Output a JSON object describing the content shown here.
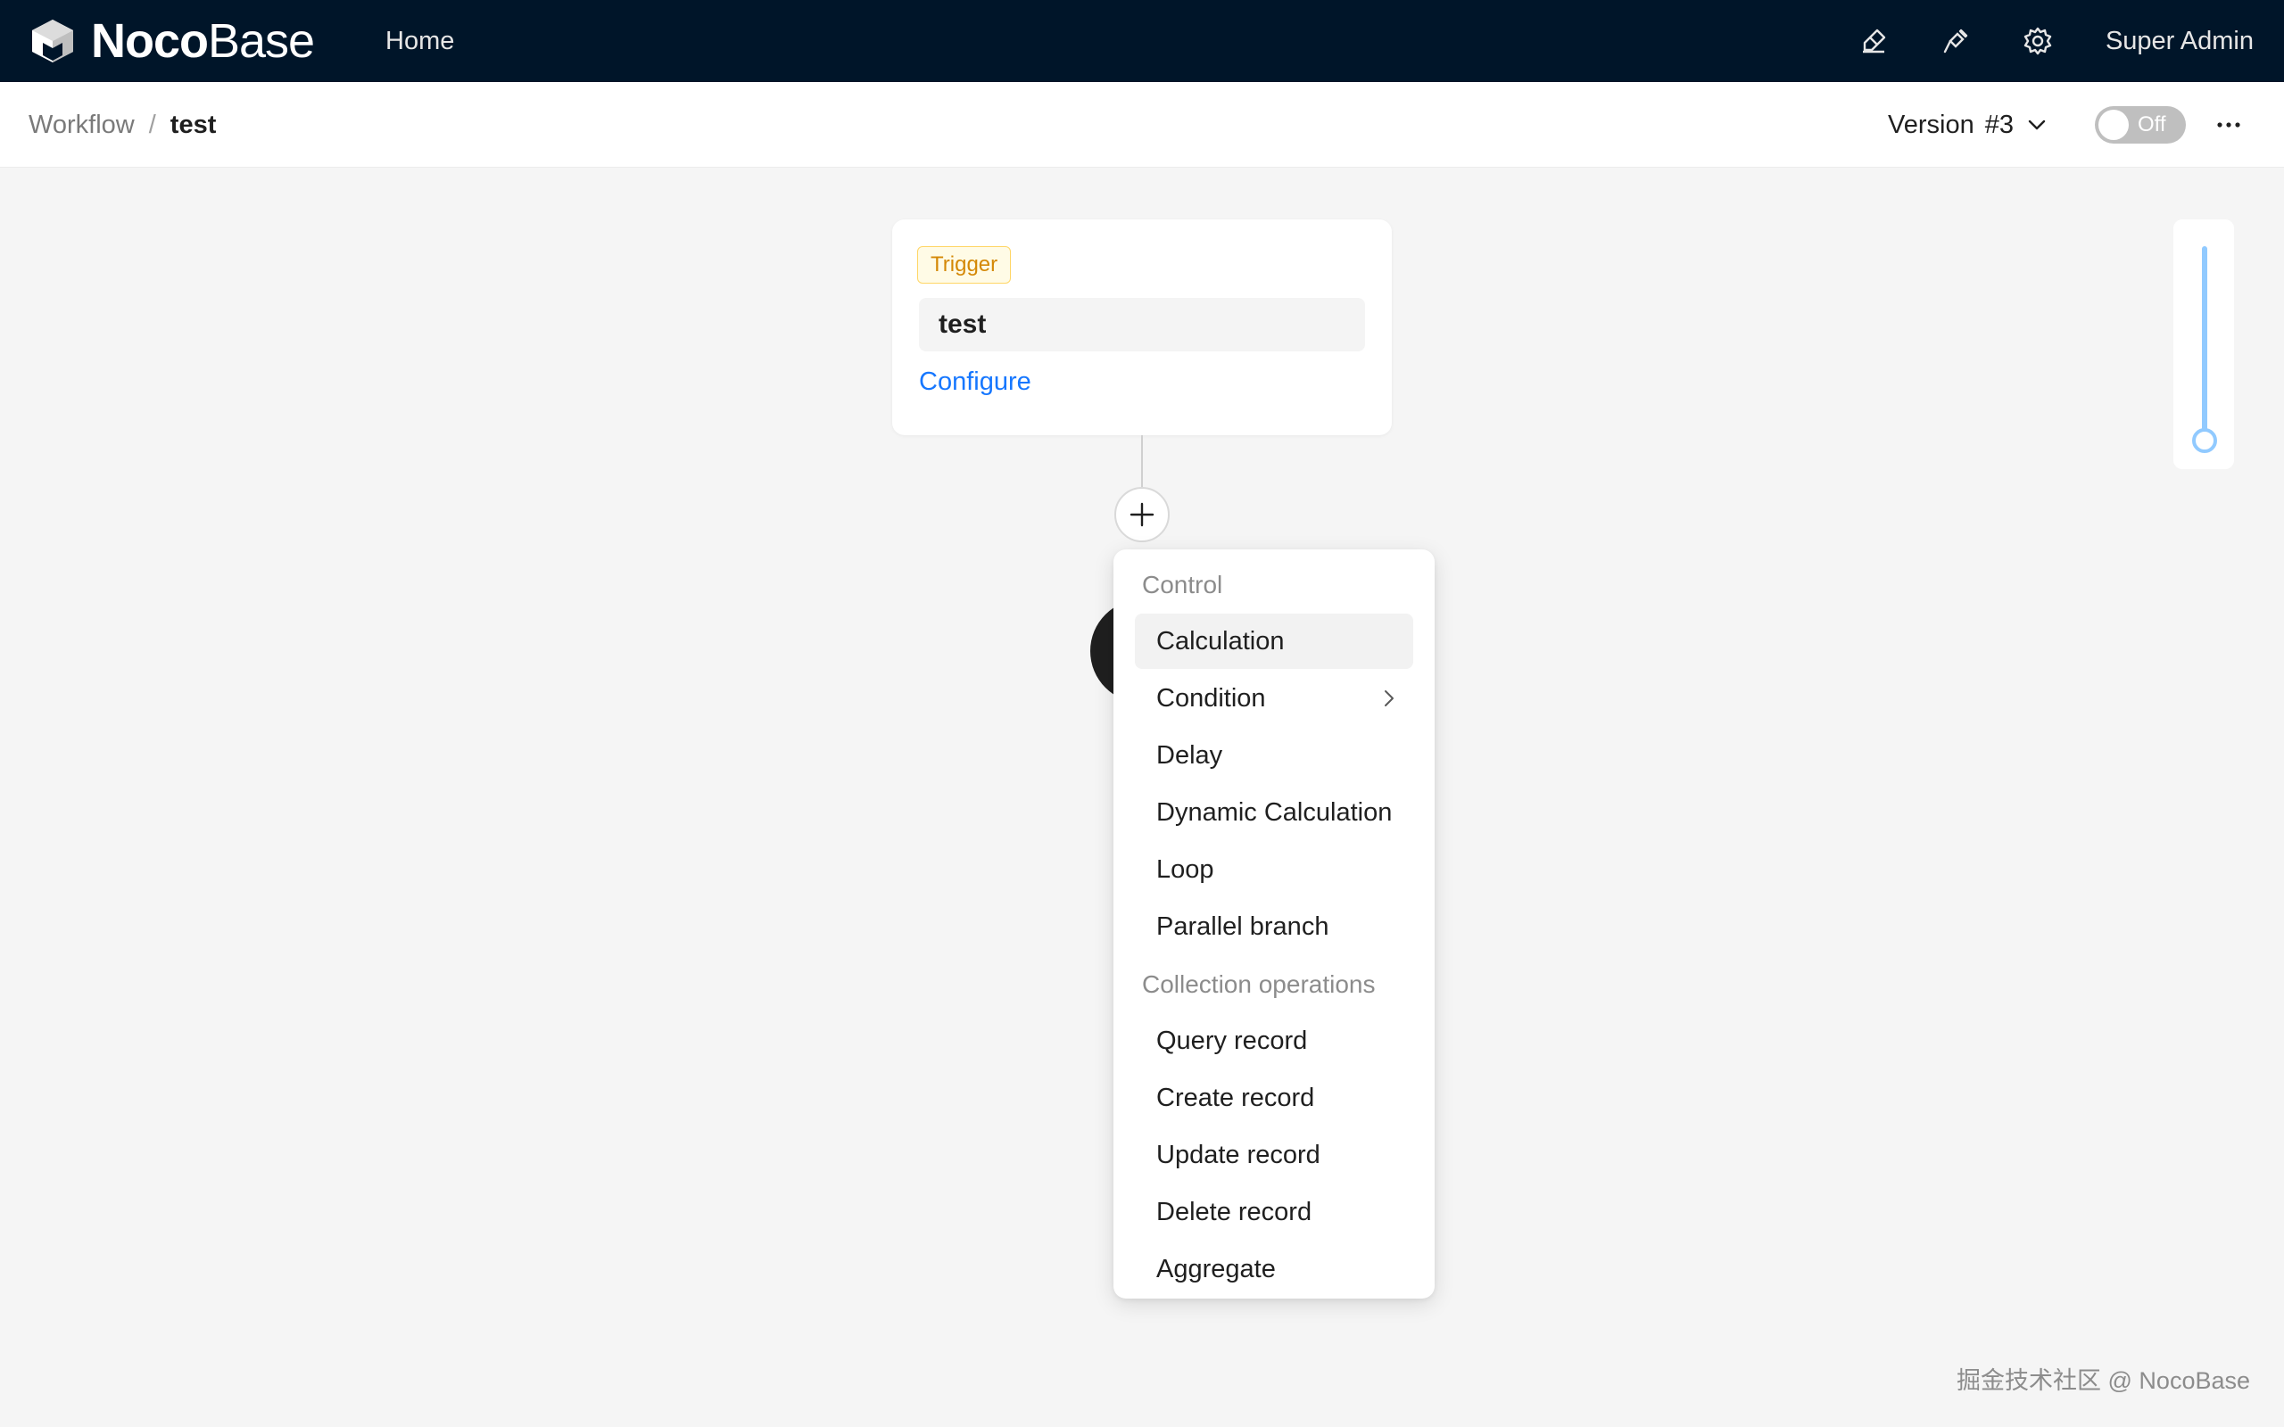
{
  "app": {
    "brand_bold": "Noco",
    "brand_light": "Base",
    "nav_home": "Home",
    "user_name": "Super Admin",
    "icons": [
      "brush-icon",
      "plug-icon",
      "gear-icon"
    ]
  },
  "breadcrumb": {
    "parent": "Workflow",
    "separator": "/",
    "current": "test"
  },
  "workflow": {
    "version_label": "Version",
    "version_value": "#3",
    "toggle_label": "Off",
    "toggle_on": false
  },
  "trigger_card": {
    "tag": "Trigger",
    "title": "test",
    "configure_label": "Configure"
  },
  "menu": {
    "groups": [
      {
        "label": "Control",
        "items": [
          "Calculation",
          "Condition",
          "Delay",
          "Dynamic Calculation",
          "Loop",
          "Parallel branch"
        ]
      },
      {
        "label": "Collection operations",
        "items": [
          "Query record",
          "Create record",
          "Update record",
          "Delete record",
          "Aggregate"
        ]
      }
    ],
    "active_item": "Calculation",
    "submenu_item": "Condition"
  },
  "watermark": "掘金技术社区 @ NocoBase",
  "colors": {
    "topbar": "#001529",
    "link": "#1677ff",
    "tag_text": "#d48806",
    "tag_bg": "#fffbe6",
    "zoom_track": "#91caff"
  }
}
